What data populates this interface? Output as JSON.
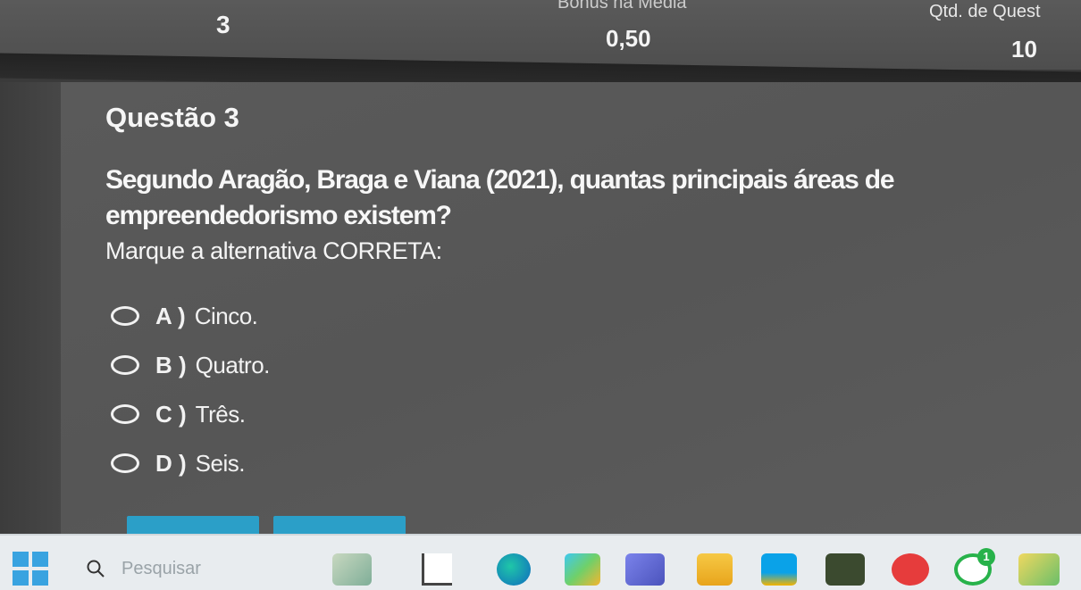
{
  "summary_bar": {
    "heading_partial": "Bônus na Média",
    "heading_right": "Qtd. de Quest",
    "left_value": "3",
    "middle_value": "0,50",
    "right_value": "10"
  },
  "question": {
    "title": "Questão 3",
    "text": "Segundo Aragão, Braga e Viana (2021), quantas principais áreas de empreendedorismo existem?",
    "instruction": "Marque a alternativa CORRETA:",
    "options": [
      {
        "letter": "A )",
        "label": "Cinco."
      },
      {
        "letter": "B )",
        "label": "Quatro."
      },
      {
        "letter": "C )",
        "label": "Três."
      },
      {
        "letter": "D )",
        "label": "Seis."
      }
    ]
  },
  "taskbar": {
    "search_placeholder": "Pesquisar",
    "notification_count": "1",
    "icons": [
      "start-icon",
      "search-icon",
      "file-explorer-icon",
      "terminal-icon",
      "edge-icon",
      "copilot-icon",
      "teams-icon",
      "file-manager-icon",
      "store-icon",
      "stock-widget-icon",
      "wps-office-icon",
      "whatsapp-icon",
      "game-icon"
    ]
  },
  "colors": {
    "accent_button": "#2b9fc8",
    "panel": "#5a5a5a",
    "taskbar": "#e8ecef"
  }
}
